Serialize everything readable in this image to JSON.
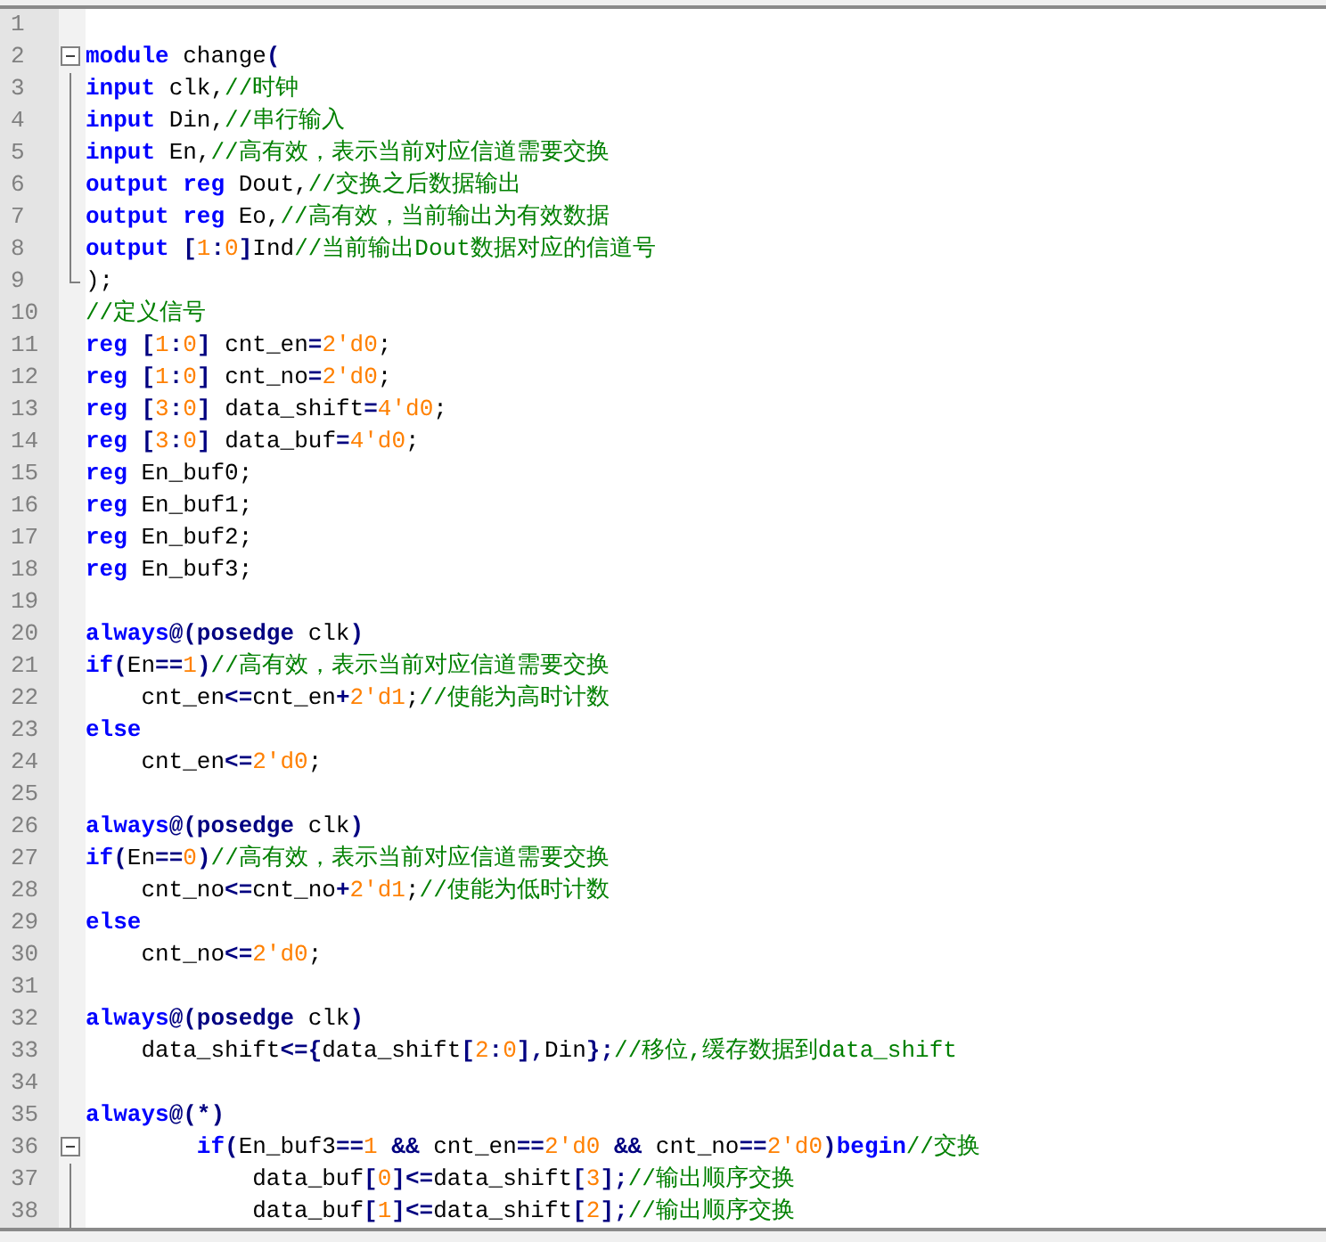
{
  "lines": [
    {
      "n": "1",
      "kind": "plain"
    },
    {
      "n": "2",
      "kind": "fold-start",
      "tokens": [
        {
          "kind": "keyword",
          "t": "module"
        },
        {
          "kind": "identifier",
          "t": " change"
        },
        {
          "kind": "operator",
          "t": "("
        }
      ]
    },
    {
      "n": "3",
      "kind": "fold-mid",
      "tokens": [
        {
          "kind": "keyword",
          "t": "input"
        },
        {
          "kind": "identifier",
          "t": " clk,"
        },
        {
          "kind": "comment",
          "t": "//时钟"
        }
      ]
    },
    {
      "n": "4",
      "kind": "fold-mid",
      "tokens": [
        {
          "kind": "keyword",
          "t": "input"
        },
        {
          "kind": "identifier",
          "t": " Din,"
        },
        {
          "kind": "comment",
          "t": "//串行输入"
        }
      ]
    },
    {
      "n": "5",
      "kind": "fold-mid",
      "tokens": [
        {
          "kind": "keyword",
          "t": "input"
        },
        {
          "kind": "identifier",
          "t": " En,"
        },
        {
          "kind": "comment",
          "t": "//高有效，表示当前对应信道需要交换"
        }
      ]
    },
    {
      "n": "6",
      "kind": "fold-mid",
      "tokens": [
        {
          "kind": "keyword",
          "t": "output reg"
        },
        {
          "kind": "identifier",
          "t": " Dout,"
        },
        {
          "kind": "comment",
          "t": "//交换之后数据输出"
        }
      ]
    },
    {
      "n": "7",
      "kind": "fold-mid",
      "tokens": [
        {
          "kind": "keyword",
          "t": "output reg"
        },
        {
          "kind": "identifier",
          "t": " Eo,"
        },
        {
          "kind": "comment",
          "t": "//高有效，当前输出为有效数据"
        }
      ]
    },
    {
      "n": "8",
      "kind": "fold-mid",
      "tokens": [
        {
          "kind": "keyword",
          "t": "output "
        },
        {
          "kind": "operator",
          "t": "["
        },
        {
          "kind": "number",
          "t": "1"
        },
        {
          "kind": "operator",
          "t": ":"
        },
        {
          "kind": "number",
          "t": "0"
        },
        {
          "kind": "operator",
          "t": "]"
        },
        {
          "kind": "identifier",
          "t": "Ind"
        },
        {
          "kind": "comment",
          "t": "//当前输出Dout数据对应的信道号"
        }
      ]
    },
    {
      "n": "9",
      "kind": "fold-end",
      "tokens": [
        {
          "kind": "identifier",
          "t": ");"
        }
      ]
    },
    {
      "n": "10",
      "kind": "plain",
      "tokens": [
        {
          "kind": "comment",
          "t": "//定义信号"
        }
      ]
    },
    {
      "n": "11",
      "kind": "plain",
      "tokens": [
        {
          "kind": "keyword",
          "t": "reg "
        },
        {
          "kind": "operator",
          "t": "["
        },
        {
          "kind": "number",
          "t": "1"
        },
        {
          "kind": "operator",
          "t": ":"
        },
        {
          "kind": "number",
          "t": "0"
        },
        {
          "kind": "operator",
          "t": "]"
        },
        {
          "kind": "identifier",
          "t": " cnt_en"
        },
        {
          "kind": "operator",
          "t": "="
        },
        {
          "kind": "number",
          "t": "2'd0"
        },
        {
          "kind": "identifier",
          "t": ";"
        }
      ]
    },
    {
      "n": "12",
      "kind": "plain",
      "tokens": [
        {
          "kind": "keyword",
          "t": "reg "
        },
        {
          "kind": "operator",
          "t": "["
        },
        {
          "kind": "number",
          "t": "1"
        },
        {
          "kind": "operator",
          "t": ":"
        },
        {
          "kind": "number",
          "t": "0"
        },
        {
          "kind": "operator",
          "t": "]"
        },
        {
          "kind": "identifier",
          "t": " cnt_no"
        },
        {
          "kind": "operator",
          "t": "="
        },
        {
          "kind": "number",
          "t": "2'd0"
        },
        {
          "kind": "identifier",
          "t": ";"
        }
      ]
    },
    {
      "n": "13",
      "kind": "plain",
      "tokens": [
        {
          "kind": "keyword",
          "t": "reg "
        },
        {
          "kind": "operator",
          "t": "["
        },
        {
          "kind": "number",
          "t": "3"
        },
        {
          "kind": "operator",
          "t": ":"
        },
        {
          "kind": "number",
          "t": "0"
        },
        {
          "kind": "operator",
          "t": "]"
        },
        {
          "kind": "identifier",
          "t": " data_shift"
        },
        {
          "kind": "operator",
          "t": "="
        },
        {
          "kind": "number",
          "t": "4'd0"
        },
        {
          "kind": "identifier",
          "t": ";"
        }
      ]
    },
    {
      "n": "14",
      "kind": "plain",
      "tokens": [
        {
          "kind": "keyword",
          "t": "reg "
        },
        {
          "kind": "operator",
          "t": "["
        },
        {
          "kind": "number",
          "t": "3"
        },
        {
          "kind": "operator",
          "t": ":"
        },
        {
          "kind": "number",
          "t": "0"
        },
        {
          "kind": "operator",
          "t": "]"
        },
        {
          "kind": "identifier",
          "t": " data_buf"
        },
        {
          "kind": "operator",
          "t": "="
        },
        {
          "kind": "number",
          "t": "4'd0"
        },
        {
          "kind": "identifier",
          "t": ";"
        }
      ]
    },
    {
      "n": "15",
      "kind": "plain",
      "tokens": [
        {
          "kind": "keyword",
          "t": "reg"
        },
        {
          "kind": "identifier",
          "t": " En_buf0;"
        }
      ]
    },
    {
      "n": "16",
      "kind": "plain",
      "tokens": [
        {
          "kind": "keyword",
          "t": "reg"
        },
        {
          "kind": "identifier",
          "t": " En_buf1;"
        }
      ]
    },
    {
      "n": "17",
      "kind": "plain",
      "tokens": [
        {
          "kind": "keyword",
          "t": "reg"
        },
        {
          "kind": "identifier",
          "t": " En_buf2;"
        }
      ]
    },
    {
      "n": "18",
      "kind": "plain",
      "tokens": [
        {
          "kind": "keyword",
          "t": "reg"
        },
        {
          "kind": "identifier",
          "t": " En_buf3;"
        }
      ]
    },
    {
      "n": "19",
      "kind": "plain"
    },
    {
      "n": "20",
      "kind": "plain",
      "tokens": [
        {
          "kind": "keyword",
          "t": "always"
        },
        {
          "kind": "operator",
          "t": "@(posedge"
        },
        {
          "kind": "identifier",
          "t": " clk"
        },
        {
          "kind": "operator",
          "t": ")"
        }
      ]
    },
    {
      "n": "21",
      "kind": "plain",
      "tokens": [
        {
          "kind": "keyword",
          "t": "if"
        },
        {
          "kind": "operator",
          "t": "("
        },
        {
          "kind": "identifier",
          "t": "En"
        },
        {
          "kind": "operator",
          "t": "=="
        },
        {
          "kind": "number",
          "t": "1"
        },
        {
          "kind": "operator",
          "t": ")"
        },
        {
          "kind": "comment",
          "t": "//高有效，表示当前对应信道需要交换"
        }
      ]
    },
    {
      "n": "22",
      "kind": "plain",
      "tokens": [
        {
          "kind": "identifier",
          "t": "    cnt_en"
        },
        {
          "kind": "operator",
          "t": "<="
        },
        {
          "kind": "identifier",
          "t": "cnt_en"
        },
        {
          "kind": "operator",
          "t": "+"
        },
        {
          "kind": "number",
          "t": "2'd1"
        },
        {
          "kind": "identifier",
          "t": ";"
        },
        {
          "kind": "comment",
          "t": "//使能为高时计数"
        }
      ]
    },
    {
      "n": "23",
      "kind": "plain",
      "tokens": [
        {
          "kind": "keyword",
          "t": "else"
        }
      ]
    },
    {
      "n": "24",
      "kind": "plain",
      "tokens": [
        {
          "kind": "identifier",
          "t": "    cnt_en"
        },
        {
          "kind": "operator",
          "t": "<="
        },
        {
          "kind": "number",
          "t": "2'd0"
        },
        {
          "kind": "identifier",
          "t": ";"
        }
      ]
    },
    {
      "n": "25",
      "kind": "plain"
    },
    {
      "n": "26",
      "kind": "plain",
      "tokens": [
        {
          "kind": "keyword",
          "t": "always"
        },
        {
          "kind": "operator",
          "t": "@(posedge"
        },
        {
          "kind": "identifier",
          "t": " clk"
        },
        {
          "kind": "operator",
          "t": ")"
        }
      ]
    },
    {
      "n": "27",
      "kind": "plain",
      "tokens": [
        {
          "kind": "keyword",
          "t": "if"
        },
        {
          "kind": "operator",
          "t": "("
        },
        {
          "kind": "identifier",
          "t": "En"
        },
        {
          "kind": "operator",
          "t": "=="
        },
        {
          "kind": "number",
          "t": "0"
        },
        {
          "kind": "operator",
          "t": ")"
        },
        {
          "kind": "comment",
          "t": "//高有效，表示当前对应信道需要交换"
        }
      ]
    },
    {
      "n": "28",
      "kind": "plain",
      "tokens": [
        {
          "kind": "identifier",
          "t": "    cnt_no"
        },
        {
          "kind": "operator",
          "t": "<="
        },
        {
          "kind": "identifier",
          "t": "cnt_no"
        },
        {
          "kind": "operator",
          "t": "+"
        },
        {
          "kind": "number",
          "t": "2'd1"
        },
        {
          "kind": "identifier",
          "t": ";"
        },
        {
          "kind": "comment",
          "t": "//使能为低时计数"
        }
      ]
    },
    {
      "n": "29",
      "kind": "plain",
      "tokens": [
        {
          "kind": "keyword",
          "t": "else"
        }
      ]
    },
    {
      "n": "30",
      "kind": "plain",
      "tokens": [
        {
          "kind": "identifier",
          "t": "    cnt_no"
        },
        {
          "kind": "operator",
          "t": "<="
        },
        {
          "kind": "number",
          "t": "2'd0"
        },
        {
          "kind": "identifier",
          "t": ";"
        }
      ]
    },
    {
      "n": "31",
      "kind": "plain"
    },
    {
      "n": "32",
      "kind": "plain",
      "tokens": [
        {
          "kind": "keyword",
          "t": "always"
        },
        {
          "kind": "operator",
          "t": "@(posedge"
        },
        {
          "kind": "identifier",
          "t": " clk"
        },
        {
          "kind": "operator",
          "t": ")"
        }
      ]
    },
    {
      "n": "33",
      "kind": "plain",
      "tokens": [
        {
          "kind": "identifier",
          "t": "    data_shift"
        },
        {
          "kind": "operator",
          "t": "<={"
        },
        {
          "kind": "identifier",
          "t": "data_shift"
        },
        {
          "kind": "operator",
          "t": "["
        },
        {
          "kind": "number",
          "t": "2"
        },
        {
          "kind": "operator",
          "t": ":"
        },
        {
          "kind": "number",
          "t": "0"
        },
        {
          "kind": "operator",
          "t": "],"
        },
        {
          "kind": "identifier",
          "t": "Din"
        },
        {
          "kind": "operator",
          "t": "};"
        },
        {
          "kind": "comment",
          "t": "//移位,缓存数据到data_shift"
        }
      ]
    },
    {
      "n": "34",
      "kind": "plain"
    },
    {
      "n": "35",
      "kind": "plain",
      "tokens": [
        {
          "kind": "keyword",
          "t": "always"
        },
        {
          "kind": "operator",
          "t": "@(*)"
        }
      ]
    },
    {
      "n": "36",
      "kind": "fold-start",
      "tokens": [
        {
          "kind": "keyword",
          "t": "        if"
        },
        {
          "kind": "operator",
          "t": "("
        },
        {
          "kind": "identifier",
          "t": "En_buf3"
        },
        {
          "kind": "operator",
          "t": "=="
        },
        {
          "kind": "number",
          "t": "1"
        },
        {
          "kind": "operator",
          "t": " &&"
        },
        {
          "kind": "identifier",
          "t": " cnt_en"
        },
        {
          "kind": "operator",
          "t": "=="
        },
        {
          "kind": "number",
          "t": "2'd0"
        },
        {
          "kind": "operator",
          "t": " &&"
        },
        {
          "kind": "identifier",
          "t": " cnt_no"
        },
        {
          "kind": "operator",
          "t": "=="
        },
        {
          "kind": "number",
          "t": "2'd0"
        },
        {
          "kind": "operator",
          "t": ")"
        },
        {
          "kind": "keyword",
          "t": "begin"
        },
        {
          "kind": "comment",
          "t": "//交换"
        }
      ]
    },
    {
      "n": "37",
      "kind": "fold-mid",
      "tokens": [
        {
          "kind": "identifier",
          "t": "            data_buf"
        },
        {
          "kind": "operator",
          "t": "["
        },
        {
          "kind": "number",
          "t": "0"
        },
        {
          "kind": "operator",
          "t": "]<="
        },
        {
          "kind": "identifier",
          "t": "data_shift"
        },
        {
          "kind": "operator",
          "t": "["
        },
        {
          "kind": "number",
          "t": "3"
        },
        {
          "kind": "operator",
          "t": "];"
        },
        {
          "kind": "comment",
          "t": "//输出顺序交换"
        }
      ]
    },
    {
      "n": "38",
      "kind": "fold-mid",
      "tokens": [
        {
          "kind": "identifier",
          "t": "            data_buf"
        },
        {
          "kind": "operator",
          "t": "["
        },
        {
          "kind": "number",
          "t": "1"
        },
        {
          "kind": "operator",
          "t": "]<="
        },
        {
          "kind": "identifier",
          "t": "data_shift"
        },
        {
          "kind": "operator",
          "t": "["
        },
        {
          "kind": "number",
          "t": "2"
        },
        {
          "kind": "operator",
          "t": "];"
        },
        {
          "kind": "comment",
          "t": "//输出顺序交换"
        }
      ]
    }
  ]
}
